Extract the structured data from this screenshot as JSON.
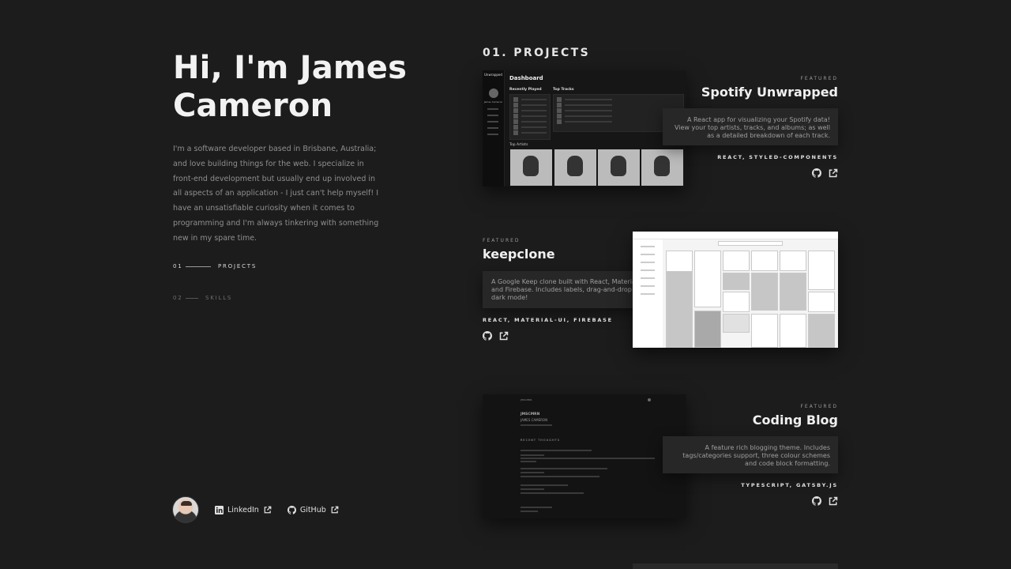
{
  "hero": {
    "title": "Hi, I'm James Cameron",
    "bio": "I'm a software developer based in Brisbane, Australia; and love building things for the web. I specialize in front-end development but usually end up involved in all aspects of an application - I just can't help myself! I have an unsatisfiable curiosity when it comes to programming and I'm always tinkering with something new in my spare time."
  },
  "nav": [
    {
      "num": "01",
      "label": "PROJECTS",
      "active": true
    },
    {
      "num": "02",
      "label": "SKILLS",
      "active": false
    }
  ],
  "social": {
    "linkedin": "LinkedIn",
    "github": "GitHub",
    "icons": [
      "linkedin-icon",
      "external-link-icon",
      "github-icon",
      "external-link-icon"
    ]
  },
  "section": {
    "title": "01. PROJECTS"
  },
  "projects": [
    {
      "featured": "FEATURED",
      "title": "Spotify Unwrapped",
      "description": "A React app for visualizing your Spotify data! View your top artists, tracks, and albums; as well as a detailed breakdown of each track.",
      "tech": "REACT, STYLED-COMPONENTS",
      "screenshot": {
        "app_name": "Unwrapped",
        "user": "James Cameron",
        "heading": "Dashboard",
        "recently_played": "Recently Played",
        "top_tracks": "Top Tracks",
        "top_artists": "Top Artists"
      }
    },
    {
      "featured": "FEATURED",
      "title": "keepclone",
      "description": "A Google Keep clone built with React, Material-UI and Firebase. Includes labels, drag-and-drop and dark mode!",
      "tech": "REACT, MATERIAL-UI, FIREBASE"
    },
    {
      "featured": "FEATURED",
      "title": "Coding Blog",
      "description": "A feature rich blogging theme. Includes tags/categories support, three colour schemes and code block formatting.",
      "tech": "TYPESCRIPT, GATSBY.JS",
      "screenshot": {
        "brand": "JMSCMRN",
        "name": "JAMES CAMERON",
        "recent": "RECENT THOUGHTS"
      }
    }
  ],
  "colors": {
    "background": "#1c1c1c",
    "card": "#272727",
    "text": "#e6e6e6",
    "muted": "#8f8f8f"
  }
}
